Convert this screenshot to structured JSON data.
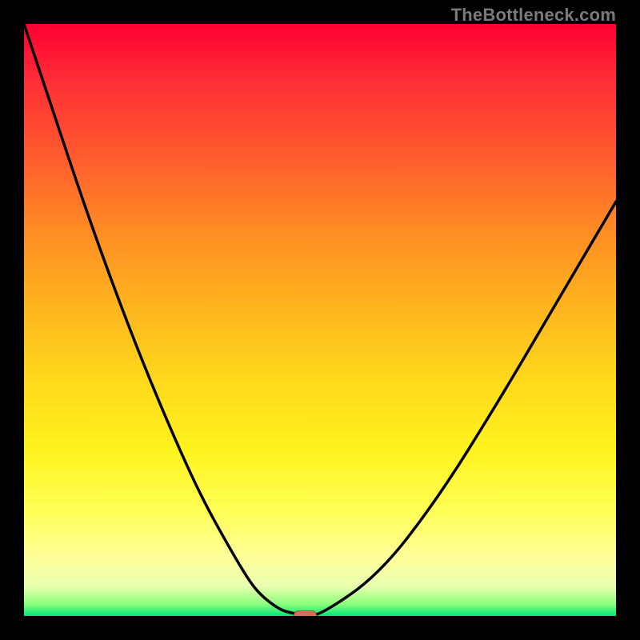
{
  "watermark": "TheBottleneck.com",
  "chart_data": {
    "type": "line",
    "title": "",
    "xlabel": "",
    "ylabel": "",
    "xlim": [
      0,
      100
    ],
    "ylim": [
      0,
      100
    ],
    "series": [
      {
        "name": "bottleneck-curve",
        "x": [
          0,
          5,
          10,
          15,
          20,
          25,
          30,
          35,
          38,
          40,
          43,
          45,
          47.5,
          50,
          60,
          70,
          80,
          90,
          100
        ],
        "y": [
          100,
          85,
          70,
          56,
          43,
          31,
          20,
          11,
          6,
          3.5,
          1.2,
          0.5,
          0.2,
          0.1,
          7,
          20,
          36,
          53,
          70
        ]
      }
    ],
    "marker": {
      "name": "optimal-point",
      "x": 47.5,
      "y": 0.2
    },
    "background": {
      "type": "vertical-gradient",
      "stops": [
        {
          "pct": 0,
          "color": "#FF0033"
        },
        {
          "pct": 50,
          "color": "#FFB51E"
        },
        {
          "pct": 80,
          "color": "#FFFF55"
        },
        {
          "pct": 100,
          "color": "#00E676"
        }
      ]
    }
  }
}
